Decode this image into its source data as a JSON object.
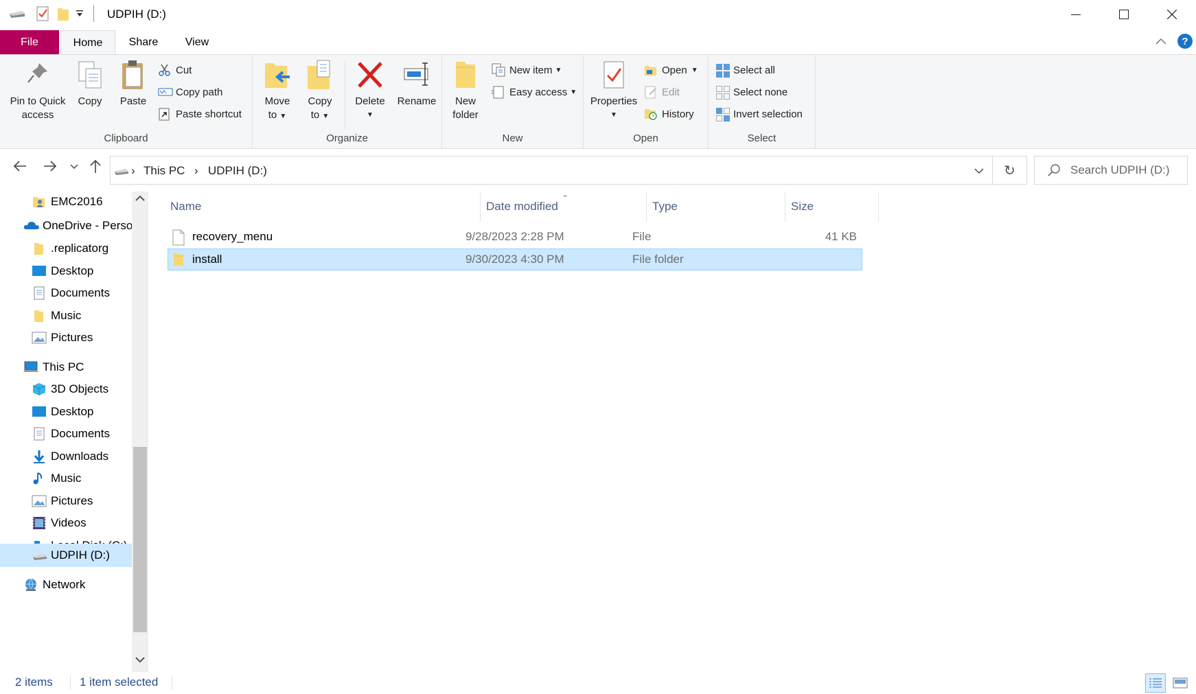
{
  "window": {
    "title": "UDPIH (D:)",
    "controls": {
      "minimize": "minimize",
      "maximize": "maximize",
      "close": "close"
    }
  },
  "tabs": {
    "file": "File",
    "home": "Home",
    "share": "Share",
    "view": "View"
  },
  "ribbon": {
    "clipboard": {
      "label": "Clipboard",
      "pin_line1": "Pin to Quick",
      "pin_line2": "access",
      "copy": "Copy",
      "paste": "Paste",
      "cut": "Cut",
      "copy_path": "Copy path",
      "paste_shortcut": "Paste shortcut"
    },
    "organize": {
      "label": "Organize",
      "move_line1": "Move",
      "move_line2": "to",
      "copy_line1": "Copy",
      "copy_line2": "to",
      "delete": "Delete",
      "rename": "Rename"
    },
    "new": {
      "label": "New",
      "folder_line1": "New",
      "folder_line2": "folder",
      "new_item": "New item",
      "easy_access": "Easy access"
    },
    "open": {
      "label": "Open",
      "properties": "Properties",
      "open": "Open",
      "edit": "Edit",
      "history": "History"
    },
    "select": {
      "label": "Select",
      "select_all": "Select all",
      "select_none": "Select none",
      "invert": "Invert selection"
    }
  },
  "address": {
    "crumbs": [
      "This PC",
      "UDPIH (D:)"
    ],
    "search_placeholder": "Search UDPIH (D:)"
  },
  "sidebar": {
    "items": [
      {
        "label": "EMC2016",
        "icon": "user-folder-icon"
      },
      {
        "label": "OneDrive - Personal",
        "icon": "onedrive-icon"
      },
      {
        "label": ".replicatorg",
        "icon": "folder-icon"
      },
      {
        "label": "Desktop",
        "icon": "desktop-icon"
      },
      {
        "label": "Documents",
        "icon": "documents-icon"
      },
      {
        "label": "Music",
        "icon": "folder-icon"
      },
      {
        "label": "Pictures",
        "icon": "pictures-icon"
      },
      {
        "label": "This PC",
        "icon": "computer-icon"
      },
      {
        "label": "3D Objects",
        "icon": "3d-objects-icon"
      },
      {
        "label": "Desktop",
        "icon": "desktop-icon"
      },
      {
        "label": "Documents",
        "icon": "documents-icon"
      },
      {
        "label": "Downloads",
        "icon": "downloads-icon"
      },
      {
        "label": "Music",
        "icon": "music-icon"
      },
      {
        "label": "Pictures",
        "icon": "pictures-icon"
      },
      {
        "label": "Videos",
        "icon": "videos-icon"
      },
      {
        "label": "Local Disk (C:)",
        "icon": "local-disk-icon"
      },
      {
        "label": "UDPIH (D:)",
        "icon": "usb-drive-icon"
      },
      {
        "label": "Network",
        "icon": "network-icon"
      }
    ]
  },
  "columns": {
    "name": "Name",
    "date": "Date modified",
    "type": "Type",
    "size": "Size"
  },
  "files": [
    {
      "name": "recovery_menu",
      "date": "9/28/2023 2:28 PM",
      "type": "File",
      "size": "41 KB",
      "icon": "file-icon"
    },
    {
      "name": "install",
      "date": "9/30/2023 4:30 PM",
      "type": "File folder",
      "size": "",
      "icon": "folder-icon"
    }
  ],
  "status": {
    "items": "2 items",
    "selected": "1 item selected"
  },
  "colors": {
    "file_tab": "#b3005a",
    "selection": "#cce8ff",
    "folder": "#f8d775",
    "accent": "#0078d7"
  }
}
